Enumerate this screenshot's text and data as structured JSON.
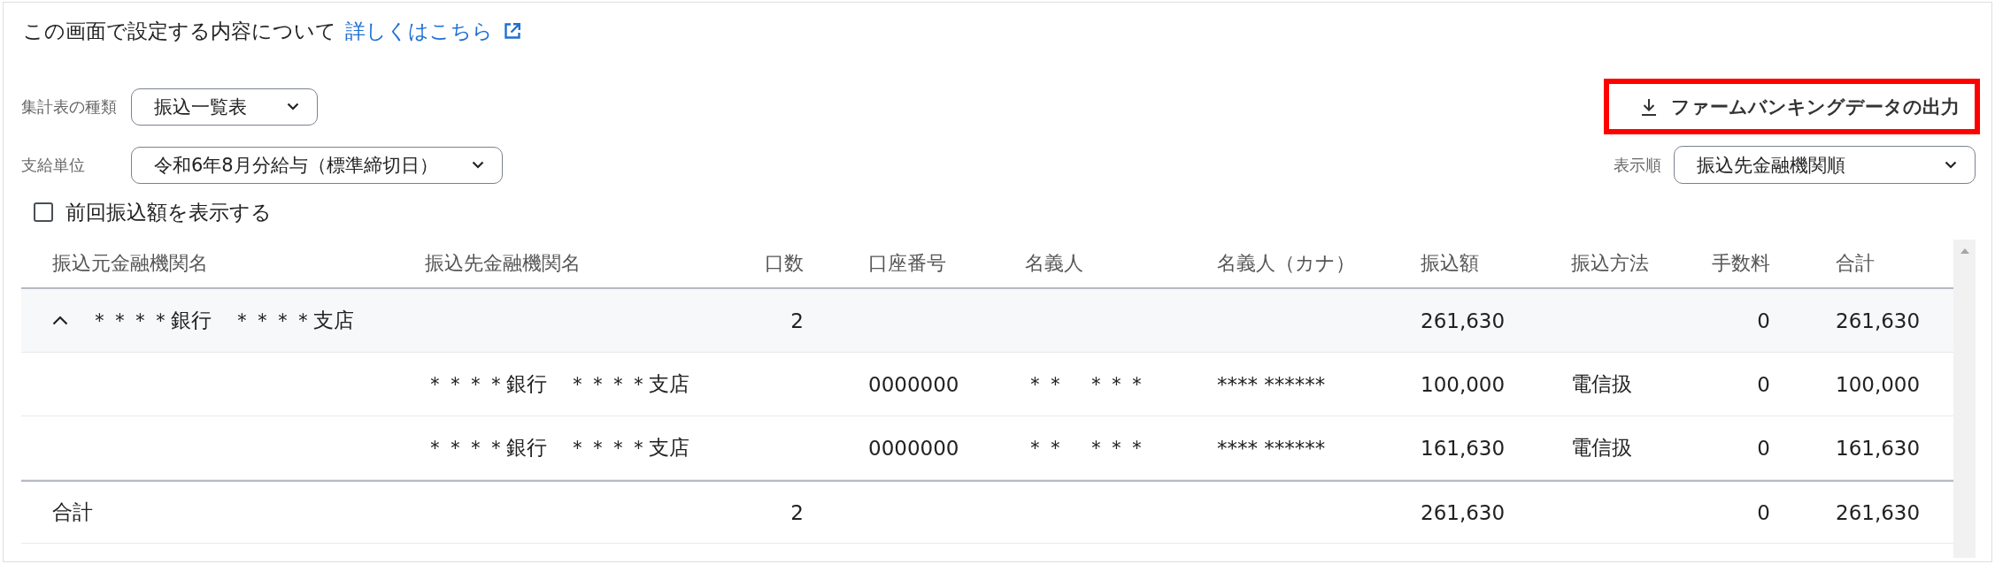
{
  "intro": {
    "text": "この画面で設定する内容について",
    "link": "詳しくはこちら"
  },
  "filters": [
    {
      "label": "集計表の種類",
      "value": "振込一覧表"
    },
    {
      "label": "支給単位",
      "value": "令和6年8月分給与（標準締切日）"
    }
  ],
  "export_button": {
    "label": "ファームバンキングデータの出力",
    "highlighted": true
  },
  "sort": {
    "label": "表示順",
    "value": "振込先金融機関順"
  },
  "show_previous": {
    "label": "前回振込額を表示する",
    "checked": false
  },
  "table": {
    "columns": [
      "振込元金融機関名",
      "振込先金融機関名",
      "口数",
      "口座番号",
      "名義人",
      "名義人（カナ）",
      "振込額",
      "振込方法",
      "手数料",
      "合計"
    ],
    "groups": [
      {
        "expanded": true,
        "source_bank": "＊＊＊＊銀行　＊＊＊＊支店",
        "count": "2",
        "amount": "261,630",
        "fee": "0",
        "total": "261,630",
        "rows": [
          {
            "dest_bank": "＊＊＊＊銀行　＊＊＊＊支店",
            "account_no": "0000000",
            "holder": "＊＊　＊＊＊",
            "holder_kana": "**** ******",
            "amount": "100,000",
            "method": "電信扱",
            "fee": "0",
            "total": "100,000"
          },
          {
            "dest_bank": "＊＊＊＊銀行　＊＊＊＊支店",
            "account_no": "0000000",
            "holder": "＊＊　＊＊＊",
            "holder_kana": "**** ******",
            "amount": "161,630",
            "method": "電信扱",
            "fee": "0",
            "total": "161,630"
          }
        ]
      }
    ],
    "total_row": {
      "label": "合計",
      "count": "2",
      "amount": "261,630",
      "fee": "0",
      "total": "261,630"
    }
  }
}
